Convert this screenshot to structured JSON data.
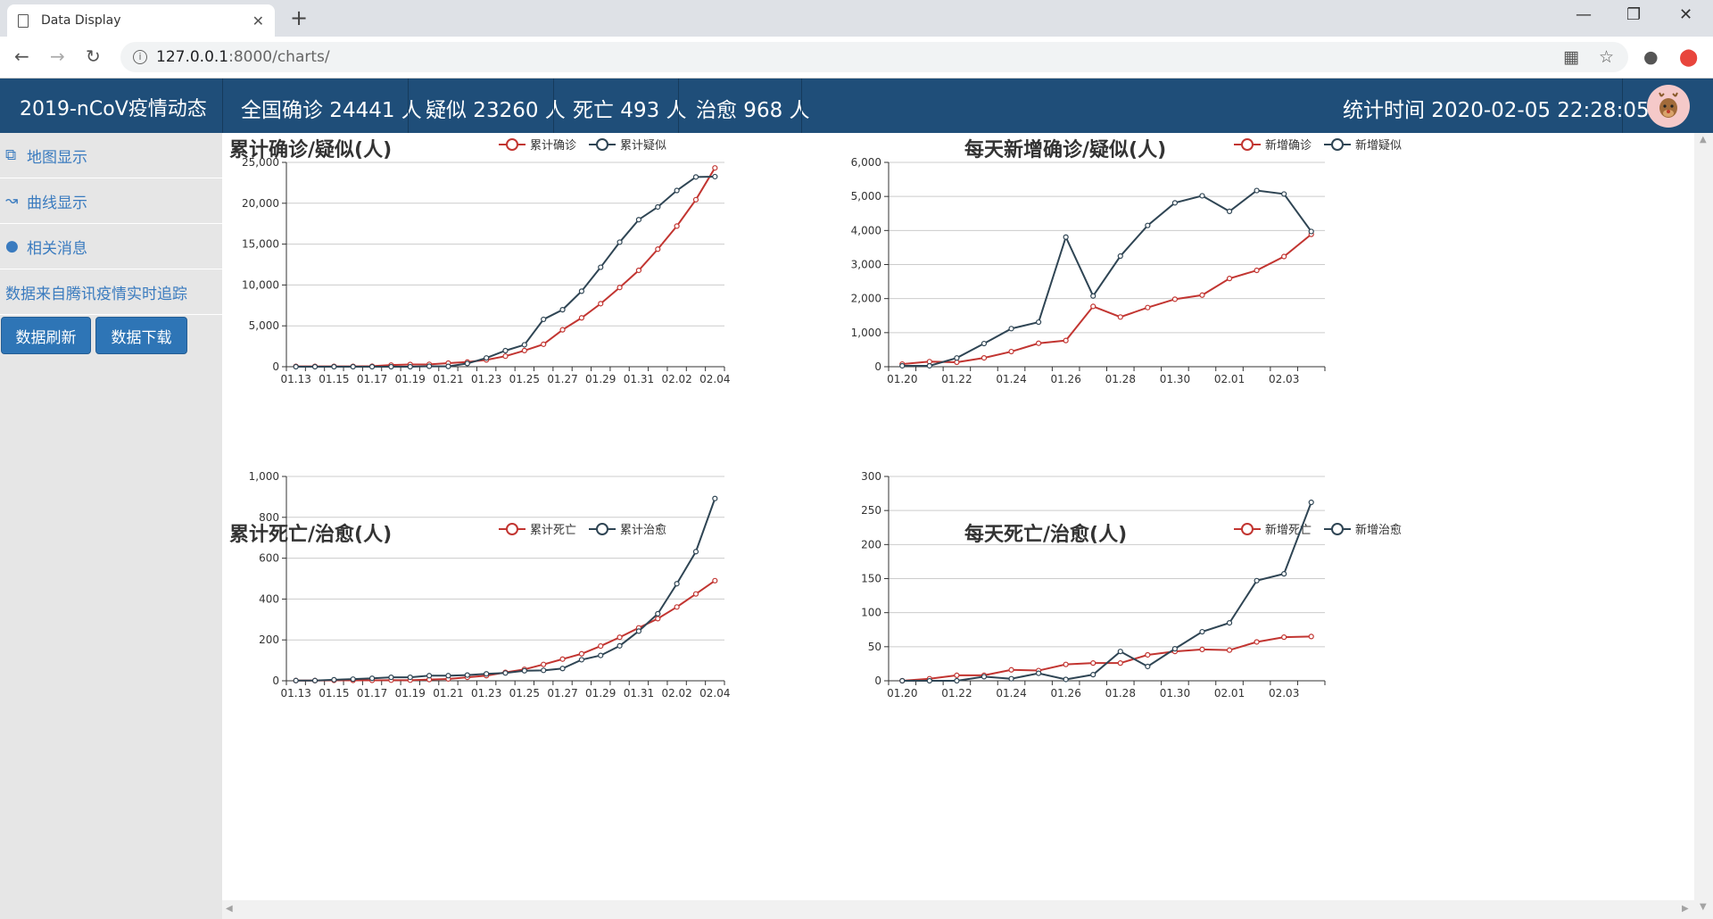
{
  "browser": {
    "tab_title": "Data Display",
    "tab_close": "✕",
    "new_tab": "+",
    "url_host": "127.0.0.1",
    "url_path": ":8000/charts/"
  },
  "header": {
    "brand": "2019-nCoV疫情动态",
    "confirmed": "全国确诊 24441 人",
    "suspected": "疑似 23260 人",
    "dead": "死亡 493 人",
    "healed": "治愈 968 人",
    "stat_time": "统计时间 2020-02-05 22:28:05"
  },
  "sidebar": {
    "items": [
      {
        "label": "地图显示",
        "icon": "clone-icon"
      },
      {
        "label": "曲线显示",
        "icon": "line-chart-icon"
      },
      {
        "label": "相关消息",
        "icon": "comment-icon"
      }
    ],
    "source_note": "数据来自腾讯疫情实时追踪",
    "refresh_label": "数据刷新",
    "download_label": "数据下载"
  },
  "colors": {
    "red": "#c23531",
    "navy": "#2f4554",
    "header": "#1f4e79"
  },
  "chart_data": [
    {
      "type": "line",
      "title": "累计确诊/疑似(人)",
      "x": [
        "01.13",
        "01.14",
        "01.15",
        "01.16",
        "01.17",
        "01.18",
        "01.19",
        "01.20",
        "01.21",
        "01.22",
        "01.23",
        "01.24",
        "01.25",
        "01.26",
        "01.27",
        "01.28",
        "01.29",
        "01.30",
        "01.31",
        "02.01",
        "02.02",
        "02.03",
        "02.04"
      ],
      "x_ticks": [
        "01.13",
        "01.15",
        "01.17",
        "01.19",
        "01.21",
        "01.23",
        "01.25",
        "01.27",
        "01.29",
        "01.31",
        "02.02",
        "02.04"
      ],
      "ylim": [
        0,
        25000
      ],
      "y_ticks": [
        "0",
        "5,000",
        "10,000",
        "15,000",
        "20,000",
        "25,000"
      ],
      "series": [
        {
          "name": "累计确诊",
          "color": "#c23531",
          "values": [
            41,
            41,
            41,
            45,
            62,
            198,
            275,
            291,
            440,
            571,
            830,
            1287,
            1975,
            2744,
            4515,
            5974,
            7711,
            9692,
            11791,
            14380,
            17205,
            20438,
            24324
          ]
        },
        {
          "name": "累计疑似",
          "color": "#2f4554",
          "values": [
            0,
            0,
            0,
            0,
            0,
            0,
            0,
            54,
            37,
            393,
            1072,
            1965,
            2684,
            5794,
            6973,
            9239,
            12167,
            15238,
            17988,
            19544,
            21558,
            23214,
            23260
          ]
        }
      ]
    },
    {
      "type": "line",
      "title": "每天新增确诊/疑似(人)",
      "x": [
        "01.20",
        "01.21",
        "01.22",
        "01.23",
        "01.24",
        "01.25",
        "01.26",
        "01.27",
        "01.28",
        "01.29",
        "01.30",
        "01.31",
        "02.01",
        "02.02",
        "02.03",
        "02.04"
      ],
      "x_ticks": [
        "01.20",
        "01.22",
        "01.24",
        "01.26",
        "01.28",
        "01.30",
        "02.01",
        "02.03"
      ],
      "ylim": [
        0,
        6000
      ],
      "y_ticks": [
        "0",
        "1,000",
        "2,000",
        "3,000",
        "4,000",
        "5,000",
        "6,000"
      ],
      "series": [
        {
          "name": "新增确诊",
          "color": "#c23531",
          "values": [
            77,
            149,
            131,
            259,
            444,
            688,
            769,
            1771,
            1459,
            1737,
            1982,
            2102,
            2590,
            2829,
            3235,
            3887
          ]
        },
        {
          "name": "新增疑似",
          "color": "#2f4554",
          "values": [
            27,
            27,
            257,
            680,
            1118,
            1309,
            3806,
            2077,
            3248,
            4148,
            4812,
            5019,
            4562,
            5173,
            5072,
            3971
          ]
        }
      ]
    },
    {
      "type": "line",
      "title": "累计死亡/治愈(人)",
      "x": [
        "01.13",
        "01.14",
        "01.15",
        "01.16",
        "01.17",
        "01.18",
        "01.19",
        "01.20",
        "01.21",
        "01.22",
        "01.23",
        "01.24",
        "01.25",
        "01.26",
        "01.27",
        "01.28",
        "01.29",
        "01.30",
        "01.31",
        "02.01",
        "02.02",
        "02.03",
        "02.04"
      ],
      "x_ticks": [
        "01.13",
        "01.15",
        "01.17",
        "01.19",
        "01.21",
        "01.23",
        "01.25",
        "01.27",
        "01.29",
        "01.31",
        "02.02",
        "02.04"
      ],
      "ylim": [
        0,
        1000
      ],
      "y_ticks": [
        "0",
        "200",
        "400",
        "600",
        "800",
        "1,000"
      ],
      "series": [
        {
          "name": "累计死亡",
          "color": "#c23531",
          "values": [
            1,
            1,
            2,
            2,
            2,
            3,
            3,
            6,
            9,
            17,
            25,
            41,
            56,
            80,
            106,
            132,
            170,
            213,
            259,
            304,
            361,
            425,
            490
          ]
        },
        {
          "name": "累计治愈",
          "color": "#2f4554",
          "values": [
            1,
            1,
            5,
            8,
            12,
            17,
            17,
            25,
            25,
            28,
            34,
            38,
            49,
            51,
            60,
            103,
            124,
            171,
            243,
            328,
            475,
            632,
            892
          ]
        }
      ]
    },
    {
      "type": "line",
      "title": "每天死亡/治愈(人)",
      "x": [
        "01.20",
        "01.21",
        "01.22",
        "01.23",
        "01.24",
        "01.25",
        "01.26",
        "01.27",
        "01.28",
        "01.29",
        "01.30",
        "01.31",
        "02.01",
        "02.02",
        "02.03",
        "02.04"
      ],
      "x_ticks": [
        "01.20",
        "01.22",
        "01.24",
        "01.26",
        "01.28",
        "01.30",
        "02.01",
        "02.03"
      ],
      "ylim": [
        0,
        300
      ],
      "y_ticks": [
        "0",
        "50",
        "100",
        "150",
        "200",
        "250",
        "300"
      ],
      "series": [
        {
          "name": "新增死亡",
          "color": "#c23531",
          "values": [
            0,
            3,
            8,
            8,
            16,
            15,
            24,
            26,
            26,
            38,
            43,
            46,
            45,
            57,
            64,
            65
          ]
        },
        {
          "name": "新增治愈",
          "color": "#2f4554",
          "values": [
            0,
            0,
            0,
            6,
            3,
            11,
            2,
            9,
            43,
            21,
            47,
            72,
            85,
            147,
            157,
            262
          ]
        }
      ]
    }
  ]
}
